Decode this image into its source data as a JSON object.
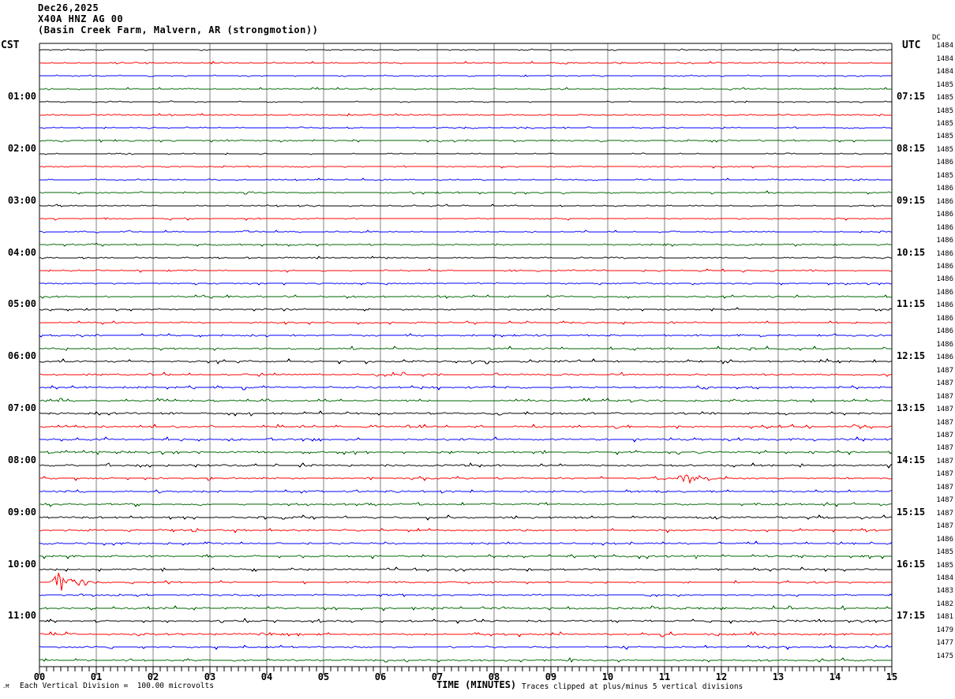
{
  "title": {
    "date": "Dec26,2025",
    "station": "X40A HNZ AG 00",
    "location": "(Basin Creek Farm, Malvern, AR (strongmotion))"
  },
  "left_axis": {
    "header": "CST",
    "hour_labels": [
      {
        "text": "01:00",
        "group": 1
      },
      {
        "text": "02:00",
        "group": 2
      },
      {
        "text": "03:00",
        "group": 3
      },
      {
        "text": "04:00",
        "group": 4
      },
      {
        "text": "05:00",
        "group": 5
      },
      {
        "text": "06:00",
        "group": 6
      },
      {
        "text": "07:00",
        "group": 7
      },
      {
        "text": "08:00",
        "group": 8
      },
      {
        "text": "09:00",
        "group": 9
      },
      {
        "text": "10:00",
        "group": 10
      },
      {
        "text": "11:00",
        "group": 11
      }
    ]
  },
  "right_axis": {
    "header": "UTC",
    "dc_header": "DC",
    "time_labels": [
      {
        "text": "07:15",
        "group": 1
      },
      {
        "text": "08:15",
        "group": 2
      },
      {
        "text": "09:15",
        "group": 3
      },
      {
        "text": "10:15",
        "group": 4
      },
      {
        "text": "11:15",
        "group": 5
      },
      {
        "text": "12:15",
        "group": 6
      },
      {
        "text": "13:15",
        "group": 7
      },
      {
        "text": "14:15",
        "group": 8
      },
      {
        "text": "15:15",
        "group": 9
      },
      {
        "text": "16:15",
        "group": 10
      },
      {
        "text": "17:15",
        "group": 11
      }
    ]
  },
  "x_axis": {
    "tick_labels": [
      "00",
      "01",
      "02",
      "03",
      "04",
      "05",
      "06",
      "07",
      "08",
      "09",
      "10",
      "11",
      "12",
      "13",
      "14",
      "15"
    ],
    "title": "TIME (MINUTES)"
  },
  "footer": {
    "logo_mark": ".M",
    "scale_note": "Each Vertical Division =  100.00 microvolts",
    "clip_note": "Traces clipped at plus/minus 5 vertical divisions"
  },
  "colors": {
    "trace_cycle": [
      "#000000",
      "#ff0000",
      "#0000ff",
      "#006400"
    ],
    "grid": "#808080",
    "border": "#000000"
  },
  "chart_data": {
    "type": "line",
    "subtype": "helicorder-seismogram",
    "title": "X40A HNZ AG 00 (Basin Creek Farm, Malvern, AR (strongmotion)), Dec26,2025",
    "xlabel": "TIME (MINUTES)",
    "x_range_minutes": [
      0,
      15
    ],
    "x_tick_labels": [
      "00",
      "01",
      "02",
      "03",
      "04",
      "05",
      "06",
      "07",
      "08",
      "09",
      "10",
      "11",
      "12",
      "13",
      "14",
      "15"
    ],
    "minutes_per_line": 15,
    "lines_total": 48,
    "lines_per_hour": 4,
    "start_time_cst": "00:00",
    "end_time_cst": "12:00",
    "utc_offset_hours": 6,
    "left_labels_cst": [
      "01:00",
      "02:00",
      "03:00",
      "04:00",
      "05:00",
      "06:00",
      "07:00",
      "08:00",
      "09:00",
      "10:00",
      "11:00"
    ],
    "right_labels_utc": [
      "07:15",
      "08:15",
      "09:15",
      "10:15",
      "11:15",
      "12:15",
      "13:15",
      "14:15",
      "15:15",
      "16:15",
      "17:15"
    ],
    "trace_color_cycle": [
      "black",
      "red",
      "blue",
      "green"
    ],
    "dc_offsets": [
      1484,
      1484,
      1484,
      1485,
      1485,
      1485,
      1485,
      1485,
      1485,
      1486,
      1485,
      1486,
      1486,
      1486,
      1486,
      1486,
      1486,
      1486,
      1486,
      1486,
      1486,
      1486,
      1486,
      1486,
      1486,
      1487,
      1487,
      1487,
      1487,
      1487,
      1487,
      1487,
      1487,
      1487,
      1487,
      1487,
      1487,
      1487,
      1486,
      1485,
      1485,
      1484,
      1483,
      1482,
      1481,
      1479,
      1477,
      1475
    ],
    "noise_level_rel": [
      0.6,
      0.6,
      0.6,
      0.9,
      0.6,
      0.6,
      0.7,
      0.9,
      0.6,
      0.7,
      0.7,
      0.9,
      0.7,
      0.7,
      0.7,
      1.0,
      0.8,
      0.8,
      0.8,
      1.0,
      0.9,
      1.0,
      1.0,
      1.2,
      1.3,
      1.2,
      1.2,
      1.4,
      1.4,
      1.3,
      1.3,
      1.4,
      1.3,
      1.2,
      1.2,
      1.3,
      1.3,
      1.2,
      1.1,
      1.3,
      1.1,
      0.9,
      0.9,
      1.3,
      1.4,
      1.3,
      1.1,
      1.2
    ],
    "events": [
      {
        "line_index": 41,
        "trace_start_cst": "10:15",
        "trace_start_utc": "16:15",
        "color": "red",
        "burst_start_min": 0.05,
        "burst_end_min": 0.9,
        "amplitude": "large (clipped)",
        "peaks": [
          {
            "t": 0.35,
            "amp": 12,
            "sigma": 0.07
          },
          {
            "t": 0.55,
            "amp": 4.5,
            "sigma": 0.14
          },
          {
            "t": 0.78,
            "amp": 8,
            "sigma": 0.05
          }
        ]
      },
      {
        "line_index": 33,
        "trace_start_cst": "08:15",
        "trace_start_utc": "14:15",
        "color": "red",
        "burst_start_min": 11.15,
        "burst_end_min": 11.95,
        "amplitude": "moderate",
        "peaks": [
          {
            "t": 11.4,
            "amp": 6,
            "sigma": 0.12
          },
          {
            "t": 11.72,
            "amp": 3.5,
            "sigma": 0.09
          }
        ]
      }
    ],
    "scale_note": "Each Vertical Division =  100.00 microvolts",
    "clip_note": "Traces clipped at plus/minus 5 vertical divisions",
    "grid": "vertical gridlines at each minute"
  }
}
